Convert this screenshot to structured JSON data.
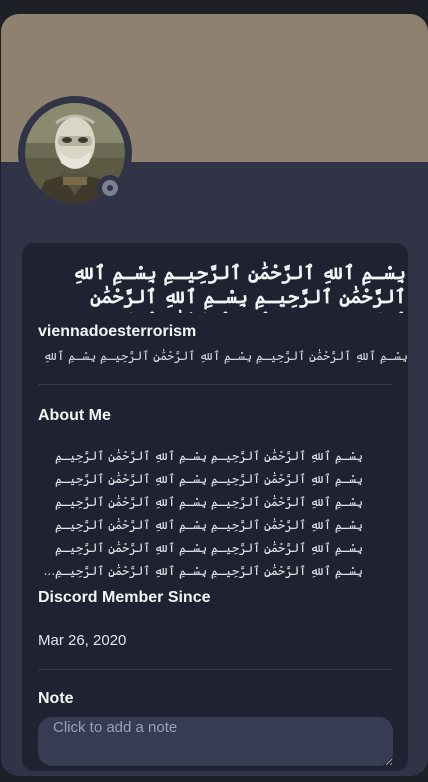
{
  "profile": {
    "display_name": "بِسْـمِ ٱللهِ ٱلرَّحْمَٰنِ ٱلرَّحِيـمِ بِسْـمِ ٱللهِ ٱلرَّحْمَٰنِ ٱلرَّحِيـمِ بِسْـمِ ٱللهِ ٱلرَّحْمَٰنِ ٱلرَّحِيـمِ بِسْـمِ ٱللهِ ٱلرَّحْمَٰنِ ٱلرَّحِيـمِ",
    "username": "viennadoesterrorism",
    "pronouns": "بِسْـمِ ٱللهِ ٱلرَّحْمَٰنِ ٱلرَّحِيـمِ بِسْـمِ ٱللهِ ٱلرَّحْمَٰنِ ٱلرَّحِيـمِ بِسْـمِ ٱللهِ ٱلرَّحْمَٰنِ ٱلرَّحِيـمِ",
    "status": "offline",
    "banner_color": "#8f8170"
  },
  "about": {
    "title": "About Me",
    "text": "بِسْـمِ ٱللهِ ٱلرَّحْمَٰنِ ٱلرَّحِيـمِ بِسْـمِ ٱللهِ ٱلرَّحْمَٰنِ ٱلرَّحِيـمِ بِسْـمِ ٱللهِ ٱلرَّحْمَٰنِ ٱلرَّحِيـمِ بِسْـمِ ٱللهِ ٱلرَّحْمَٰنِ ٱلرَّحِيـمِ بِسْـمِ ٱللهِ ٱلرَّحْمَٰنِ ٱلرَّحِيـمِ بِسْـمِ ٱللهِ ٱلرَّحْمَٰنِ ٱلرَّحِيـمِ بِسْـمِ ٱللهِ ٱلرَّحْمَٰنِ ٱلرَّحِيـمِ بِسْـمِ ٱللهِ ٱلرَّحْمَٰنِ ٱلرَّحِيـمِ بِسْـمِ ٱللهِ ٱلرَّحْمَٰنِ ٱلرَّحِيـمِ بِسْـمِ ٱللهِ ٱلرَّحْمَٰنِ ٱلرَّحِيـمِ بِسْـمِ ٱللهِ ٱلرَّحْمَٰنِ ٱلرَّحِيـمِ بِسْـمِ ٱللهِ ٱلرَّحْمَٰنِ ٱلرَّحِيـمِ..."
  },
  "member_since": {
    "title": "Discord Member Since",
    "date": "Mar 26, 2020"
  },
  "note": {
    "title": "Note",
    "placeholder": "Click to add a note"
  }
}
